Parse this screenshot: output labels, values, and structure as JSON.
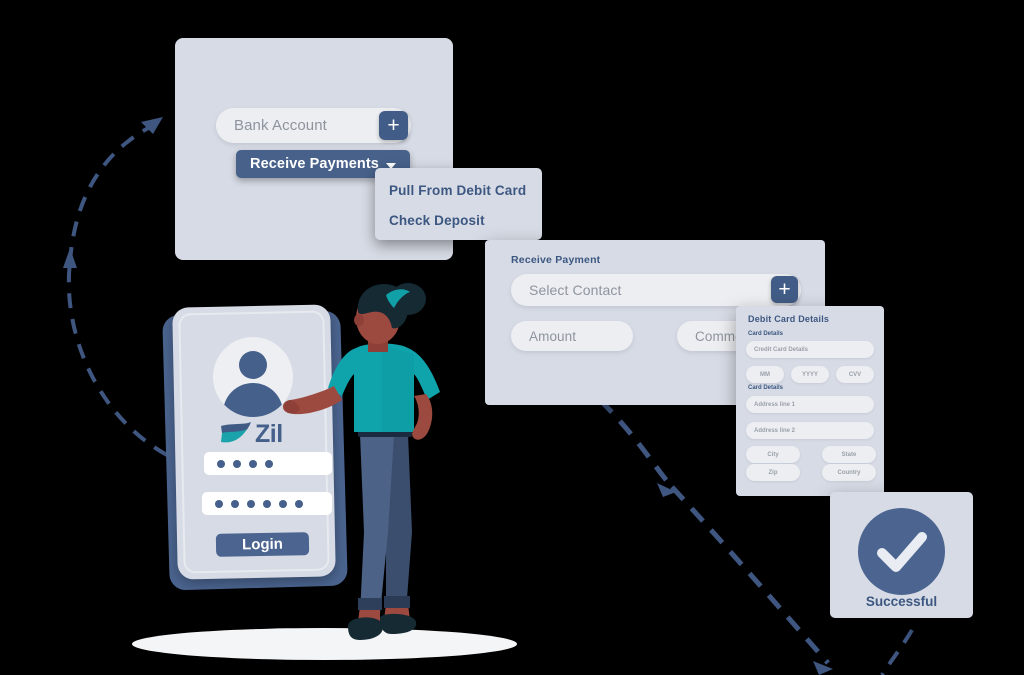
{
  "theme": {
    "background": "#000000",
    "panel": "#d7dbe5",
    "field": "#eceef1",
    "accent": "#44608b",
    "accent_dark": "#3c5781",
    "button": "#47618a",
    "placeholder": "#8e949f",
    "teal": "#12a0a8",
    "skin": "#9c4a40",
    "hair": "#152a33",
    "jeans": "#4d6287",
    "arrow": "#47618a",
    "floor": "#f4f5f7"
  },
  "bank_card": {
    "account_field": {
      "placeholder": "Bank Account"
    },
    "add_label": "+",
    "receive_button": {
      "label": "Receive Payments"
    },
    "dropdown": {
      "items": [
        {
          "label": "Pull From Debit Card"
        },
        {
          "label": "Check Deposit"
        }
      ]
    }
  },
  "receive_payment_card": {
    "title": "Receive Payment",
    "contact_field": {
      "placeholder": "Select Contact"
    },
    "add_label": "+",
    "amount_field": {
      "placeholder": "Amount"
    },
    "comment_field": {
      "placeholder": "Comment"
    }
  },
  "debit_card_panel": {
    "title": "Debit Card Details",
    "section_one_label": "Card Details",
    "section_two_label": "Card Details",
    "credit_card_field": {
      "placeholder": "Credit Card Details"
    },
    "expiry": [
      {
        "placeholder": "MM"
      },
      {
        "placeholder": "YYYY"
      },
      {
        "placeholder": "CVV"
      }
    ],
    "address": [
      {
        "placeholder": "Address line 1"
      },
      {
        "placeholder": "Address line 2"
      }
    ],
    "location": [
      {
        "placeholder": "City"
      },
      {
        "placeholder": "State"
      },
      {
        "placeholder": "Zip"
      },
      {
        "placeholder": "Country"
      }
    ]
  },
  "success_card": {
    "label": "Successful",
    "icon": "check-icon"
  },
  "phone": {
    "brand": "Zil",
    "avatar_icon": "user-avatar-icon",
    "pin_field": {
      "dots": 4
    },
    "password_field": {
      "dots": 6
    },
    "login_button": {
      "label": "Login"
    }
  },
  "icons": {
    "plus": "plus-icon",
    "caret_down": "chevron-down-icon",
    "check": "check-icon",
    "leaf": "zil-leaf-logo"
  }
}
